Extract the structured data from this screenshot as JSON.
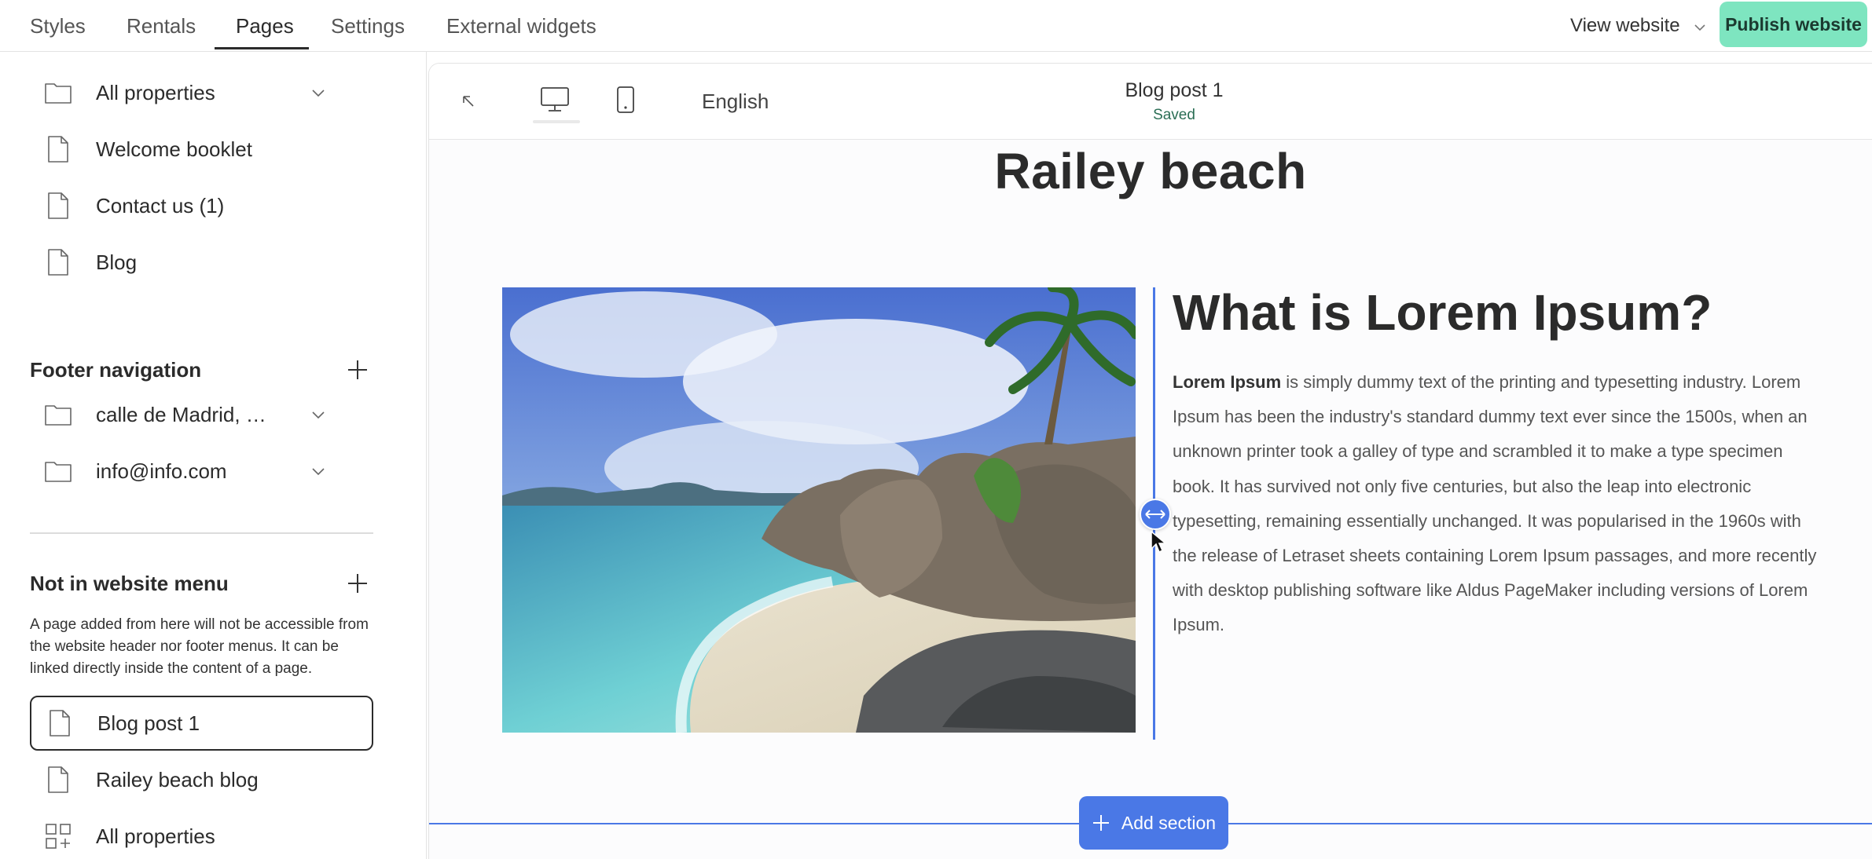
{
  "topbar": {
    "tabs": [
      {
        "label": "Styles"
      },
      {
        "label": "Rentals"
      },
      {
        "label": "Pages"
      },
      {
        "label": "Settings"
      },
      {
        "label": "External widgets"
      }
    ],
    "view_website": "View website",
    "publish": "Publish website"
  },
  "sidebar": {
    "main_items": [
      {
        "label": "All properties",
        "icon": "folder-icon"
      },
      {
        "label": "Welcome booklet",
        "icon": "page-icon"
      },
      {
        "label": "Contact us (1)",
        "icon": "page-icon"
      },
      {
        "label": "Blog",
        "icon": "page-icon"
      }
    ],
    "footer_title": "Footer navigation",
    "footer_items": [
      {
        "label": "calle de Madrid, …",
        "icon": "folder-icon"
      },
      {
        "label": "info@info.com",
        "icon": "folder-icon"
      }
    ],
    "not_in_menu_title": "Not in website menu",
    "not_in_menu_help": "A page added from here will not be accessible from the website header nor footer menus. It can be linked directly inside the content of a page.",
    "not_in_menu_items": [
      {
        "label": "Blog post 1",
        "icon": "page-icon",
        "selected": true
      },
      {
        "label": "Railey beach blog",
        "icon": "page-icon"
      },
      {
        "label": "All properties",
        "icon": "grid-plus-icon"
      }
    ]
  },
  "editor": {
    "language": "English",
    "doc_title": "Blog post 1",
    "doc_status": "Saved",
    "page_heading": "Railey beach",
    "content_heading": "What is Lorem Ipsum?",
    "body_bold": "Lorem Ipsum",
    "body_rest": " is simply dummy text of the printing and typesetting industry. Lorem Ipsum has been the industry's standard dummy text ever since the 1500s, when an unknown printer took a galley of type and scrambled it to make a type specimen book. It has survived not only five centuries, but also the leap into electronic typesetting, remaining essentially unchanged. It was popularised in the 1960s with the release of Letraset sheets containing Lorem Ipsum passages, and more recently with desktop publishing software like Aldus PageMaker including versions of Lorem Ipsum.",
    "add_section": "Add section",
    "accent_color": "#4a78e6",
    "publish_color": "#7ee5c0"
  }
}
